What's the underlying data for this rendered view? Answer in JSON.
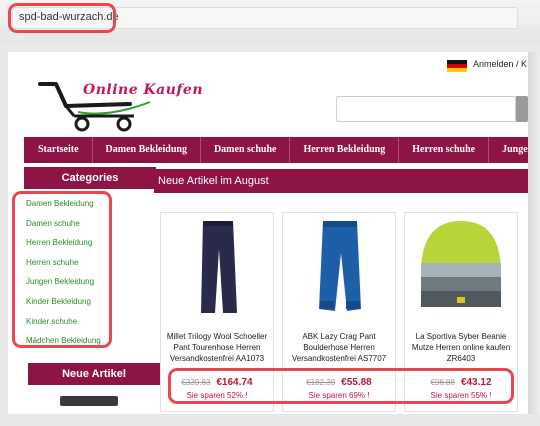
{
  "browser": {
    "url": "spd-bad-wurzach.de"
  },
  "header": {
    "login_label": "Anmelden / K",
    "logo_text": "Online Kaufen"
  },
  "nav": {
    "items": [
      "Startseite",
      "Damen Bekleidung",
      "Damen schuhe",
      "Herren Bekleidung",
      "Herren schuhe",
      "Jungen Bekleidung"
    ]
  },
  "sidebar": {
    "categories_title": "Categories",
    "categories": [
      "Damen Bekleidung",
      "Damen schuhe",
      "Herren Bekleidung",
      "Herren schuhe",
      "Jungen Bekleidung",
      "Kinder Bekleidung",
      "Kinder schuhe",
      "Mädchen Bekleidung"
    ],
    "new_title": "Neue Artikel"
  },
  "main": {
    "title": "Neue Artikel im August",
    "products": [
      {
        "title": "Millet Trilogy Wool Schoeller Pant Tourenhose Herren Versandkostenfrei AA1073",
        "old_price": "€339.83",
        "new_price": "€164.74",
        "save": "Sie sparen 52% !"
      },
      {
        "title": "ABK Lazy Crag Pant Boulderhose Herren Versandkostenfrei AS7707",
        "old_price": "€182.39",
        "new_price": "€55.88",
        "save": "Sie sparen 69% !"
      },
      {
        "title": "La Sportiva Syber Beanie Mutze Herren online kaufen ZR6403",
        "old_price": "€96.88",
        "new_price": "€43.12",
        "save": "Sie sparen 55% !"
      }
    ]
  },
  "colors": {
    "brand": "#8e1446",
    "price": "#c0143c",
    "link": "#2c8a2c",
    "highlight": "#e8474f"
  }
}
